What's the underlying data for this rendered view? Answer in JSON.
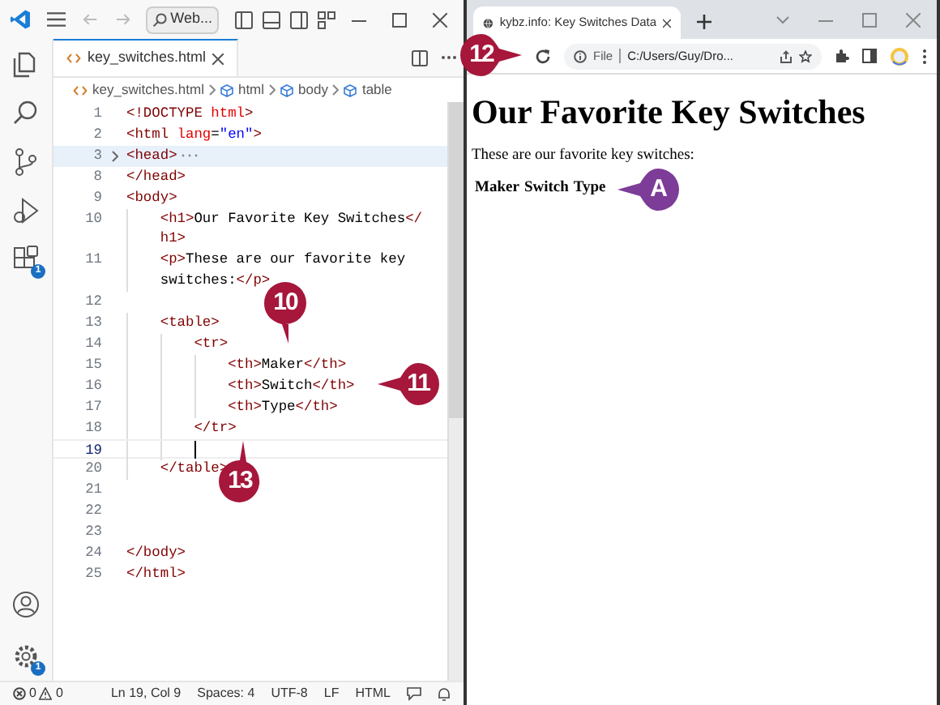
{
  "editor": {
    "title_search": "Web...",
    "tab": {
      "label": "key_switches.html",
      "selected": true
    },
    "breadcrumb": [
      "key_switches.html",
      "html",
      "body",
      "table"
    ],
    "activity_bar": [
      {
        "kind": "files"
      },
      {
        "kind": "search"
      },
      {
        "kind": "source_control"
      },
      {
        "kind": "run"
      },
      {
        "kind": "extensions",
        "badge": "1"
      }
    ],
    "activity_bar_bottom": [
      {
        "kind": "account"
      },
      {
        "kind": "settings",
        "badge": "1"
      }
    ],
    "lines": [
      {
        "number": "1",
        "text": "<!DOCTYPE html>"
      },
      {
        "number": "2",
        "text": "<html lang=\"en\">"
      },
      {
        "number": "3",
        "text": "<head>",
        "folded": true
      },
      {
        "number": "8",
        "text": "</head>"
      },
      {
        "number": "9",
        "text": "<body>"
      },
      {
        "number": "10",
        "text": "    <h1>Our Favorite Key Switches</",
        "wrap": "h1>"
      },
      {
        "number": "11",
        "text": "    <p>These are our favorite key switches:</p>"
      },
      {
        "number": "12"
      },
      {
        "number": "13",
        "text": "    <table>"
      },
      {
        "number": "14",
        "text": "        <tr>"
      },
      {
        "number": "15",
        "text": "            <th>Maker</th>"
      },
      {
        "number": "16",
        "text": "            <th>Switch</th>"
      },
      {
        "number": "17",
        "text": "            <th>Type</th>"
      },
      {
        "number": "18",
        "text": "        </tr>"
      },
      {
        "number": "19",
        "current": true
      },
      {
        "number": "20",
        "text": "    </table>"
      },
      {
        "number": "21"
      },
      {
        "number": "22"
      },
      {
        "number": "23"
      },
      {
        "number": "24",
        "text": "</body>"
      },
      {
        "number": "25",
        "text": "</html>"
      }
    ],
    "status_bar": {
      "errors": "0",
      "warnings": "0",
      "items": [
        "Ln 19, Col 9",
        "Spaces: 4",
        "UTF-8",
        "LF",
        "HTML"
      ]
    }
  },
  "browser": {
    "tab": {
      "title": "kybz.info: Key Switches Data",
      "selected": true
    },
    "address": {
      "scheme": "File",
      "url": "C:/Users/Guy/Dro..."
    },
    "page": {
      "heading": "Our Favorite Key Switches",
      "paragraph": "These are our favorite key switches:",
      "table_headers": [
        "Maker",
        "Switch",
        "Type"
      ]
    }
  },
  "callouts": [
    {
      "label": "12",
      "kind": "right",
      "color": "#a6173b"
    },
    {
      "label": "10",
      "kind": "down",
      "color": "#a6173b"
    },
    {
      "label": "11",
      "kind": "left",
      "color": "#a6173b"
    },
    {
      "label": "13",
      "kind": "up",
      "color": "#a6173b"
    },
    {
      "label": "A",
      "kind": "left",
      "color": "#7d3c98"
    }
  ]
}
